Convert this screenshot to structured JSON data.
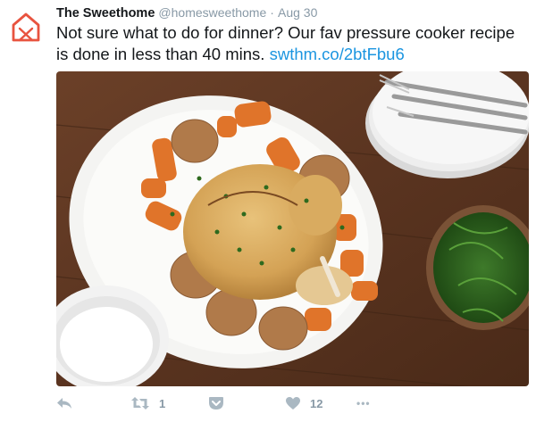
{
  "tweet": {
    "display_name": "The Sweethome",
    "handle": "@homesweethome",
    "separator": "·",
    "timestamp": "Aug 30",
    "text": "Not sure what to do for dinner? Our fav pressure cooker recipe is done in less than 40 mins.",
    "link": "swthm.co/2btFbu6",
    "brand_color": "#e8533f",
    "link_color": "#1b95e0"
  },
  "media": {
    "description_icon": "photo-roast-chicken"
  },
  "actions": {
    "reply_icon": "reply-icon",
    "retweet_icon": "retweet-icon",
    "retweet_count": "1",
    "pocket_icon": "pocket-icon",
    "like_icon": "heart-icon",
    "like_count": "12",
    "more_icon": "more-icon",
    "more_label": "•••"
  }
}
